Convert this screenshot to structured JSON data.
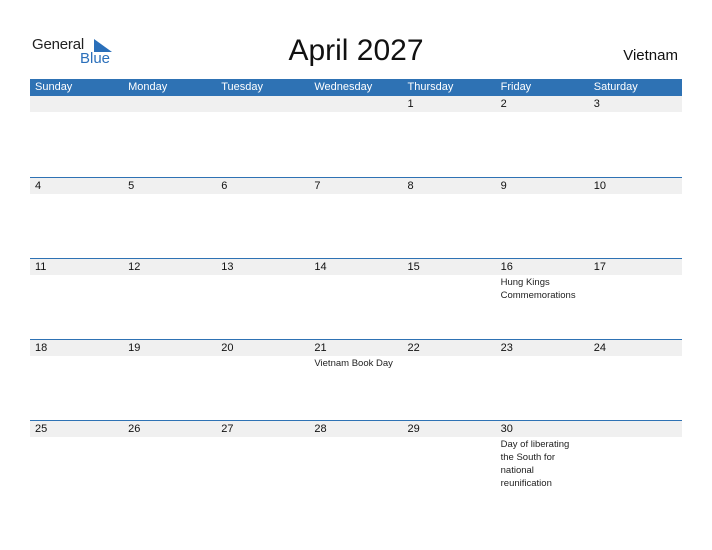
{
  "logo": {
    "word1": "General",
    "word2": "Blue"
  },
  "title": "April 2027",
  "country": "Vietnam",
  "colors": {
    "accent": "#2e72b4",
    "band": "#f0f0f0"
  },
  "weekdays": [
    "Sunday",
    "Monday",
    "Tuesday",
    "Wednesday",
    "Thursday",
    "Friday",
    "Saturday"
  ],
  "weeks": [
    [
      {
        "d": ""
      },
      {
        "d": ""
      },
      {
        "d": ""
      },
      {
        "d": ""
      },
      {
        "d": "1"
      },
      {
        "d": "2"
      },
      {
        "d": "3"
      }
    ],
    [
      {
        "d": "4"
      },
      {
        "d": "5"
      },
      {
        "d": "6"
      },
      {
        "d": "7"
      },
      {
        "d": "8"
      },
      {
        "d": "9"
      },
      {
        "d": "10"
      }
    ],
    [
      {
        "d": "11"
      },
      {
        "d": "12"
      },
      {
        "d": "13"
      },
      {
        "d": "14"
      },
      {
        "d": "15"
      },
      {
        "d": "16",
        "e": "Hung Kings Commemorations"
      },
      {
        "d": "17"
      }
    ],
    [
      {
        "d": "18"
      },
      {
        "d": "19"
      },
      {
        "d": "20"
      },
      {
        "d": "21",
        "e": "Vietnam Book Day"
      },
      {
        "d": "22"
      },
      {
        "d": "23"
      },
      {
        "d": "24"
      }
    ],
    [
      {
        "d": "25"
      },
      {
        "d": "26"
      },
      {
        "d": "27"
      },
      {
        "d": "28"
      },
      {
        "d": "29"
      },
      {
        "d": "30",
        "e": "Day of liberating the South for national reunification"
      },
      {
        "d": ""
      }
    ]
  ]
}
